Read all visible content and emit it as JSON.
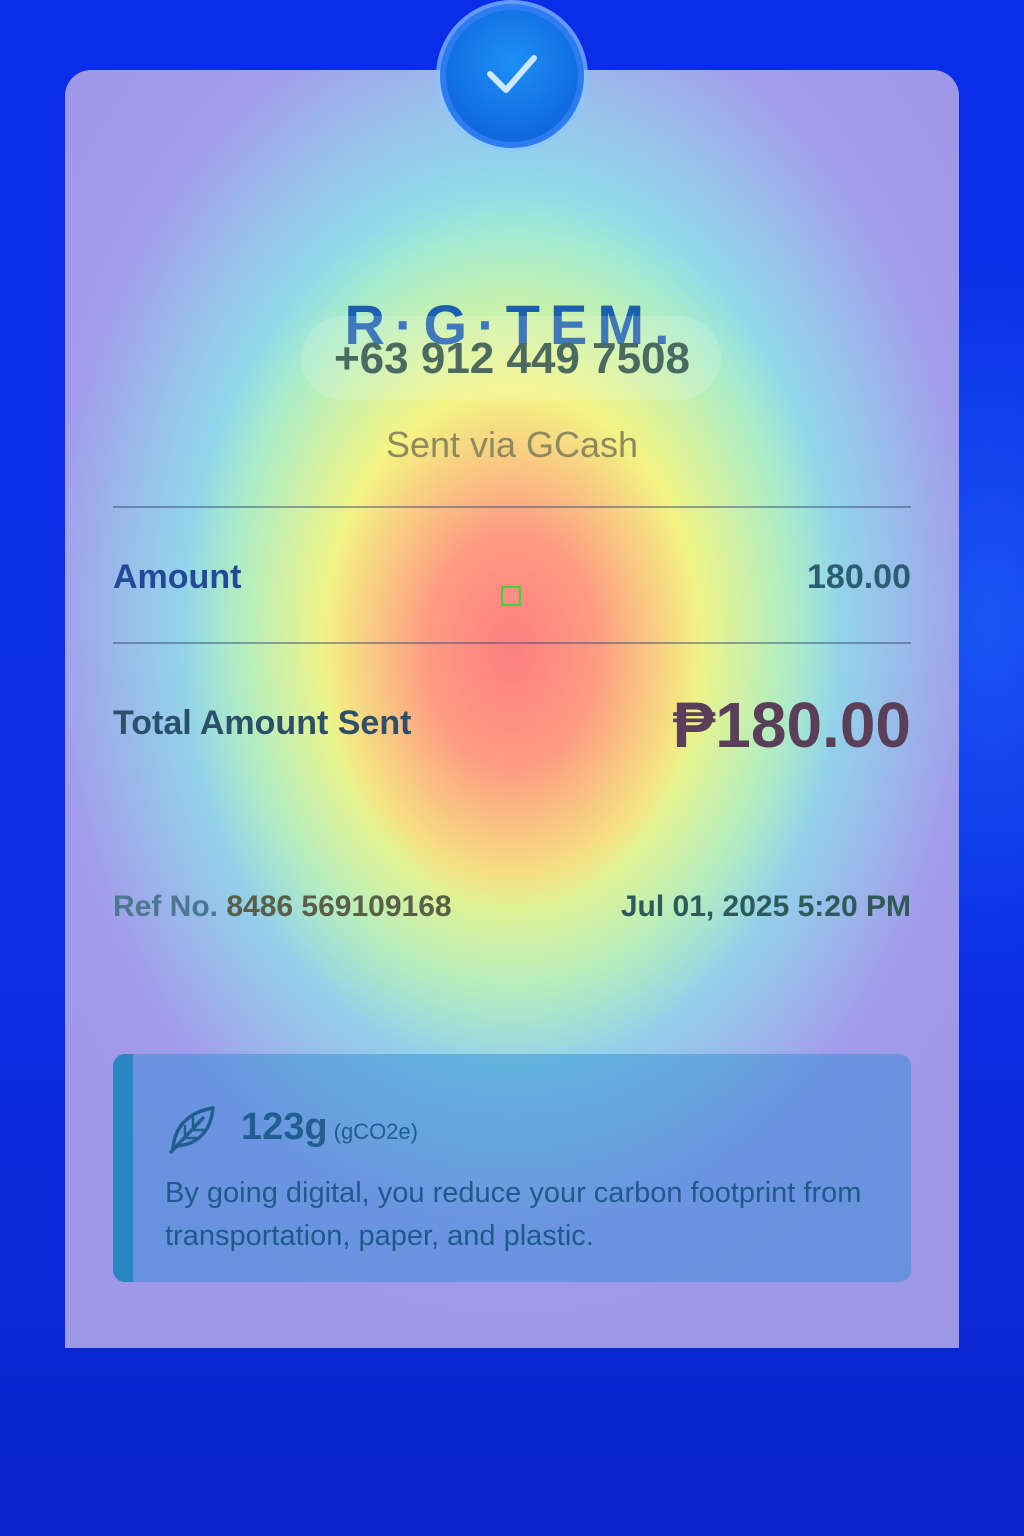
{
  "recipient": {
    "name": "R·G·TEM.",
    "phone": "+63 912 449 7508",
    "sent_via": "Sent via GCash"
  },
  "amount": {
    "label": "Amount",
    "value": "180.00"
  },
  "total": {
    "label": "Total Amount Sent",
    "value": "₱180.00"
  },
  "reference": {
    "label": "Ref No.",
    "number": "8486 569109168",
    "datetime": "Jul 01, 2025 5:20 PM"
  },
  "carbon": {
    "value": "123g",
    "unit": "(gCO2e)",
    "message": "By going digital, you reduce your carbon footprint from transportation, paper, and plastic.",
    "icon": "leaf-icon"
  },
  "colors": {
    "background": "#0a2ee8",
    "badge": "#1d8ff5"
  }
}
